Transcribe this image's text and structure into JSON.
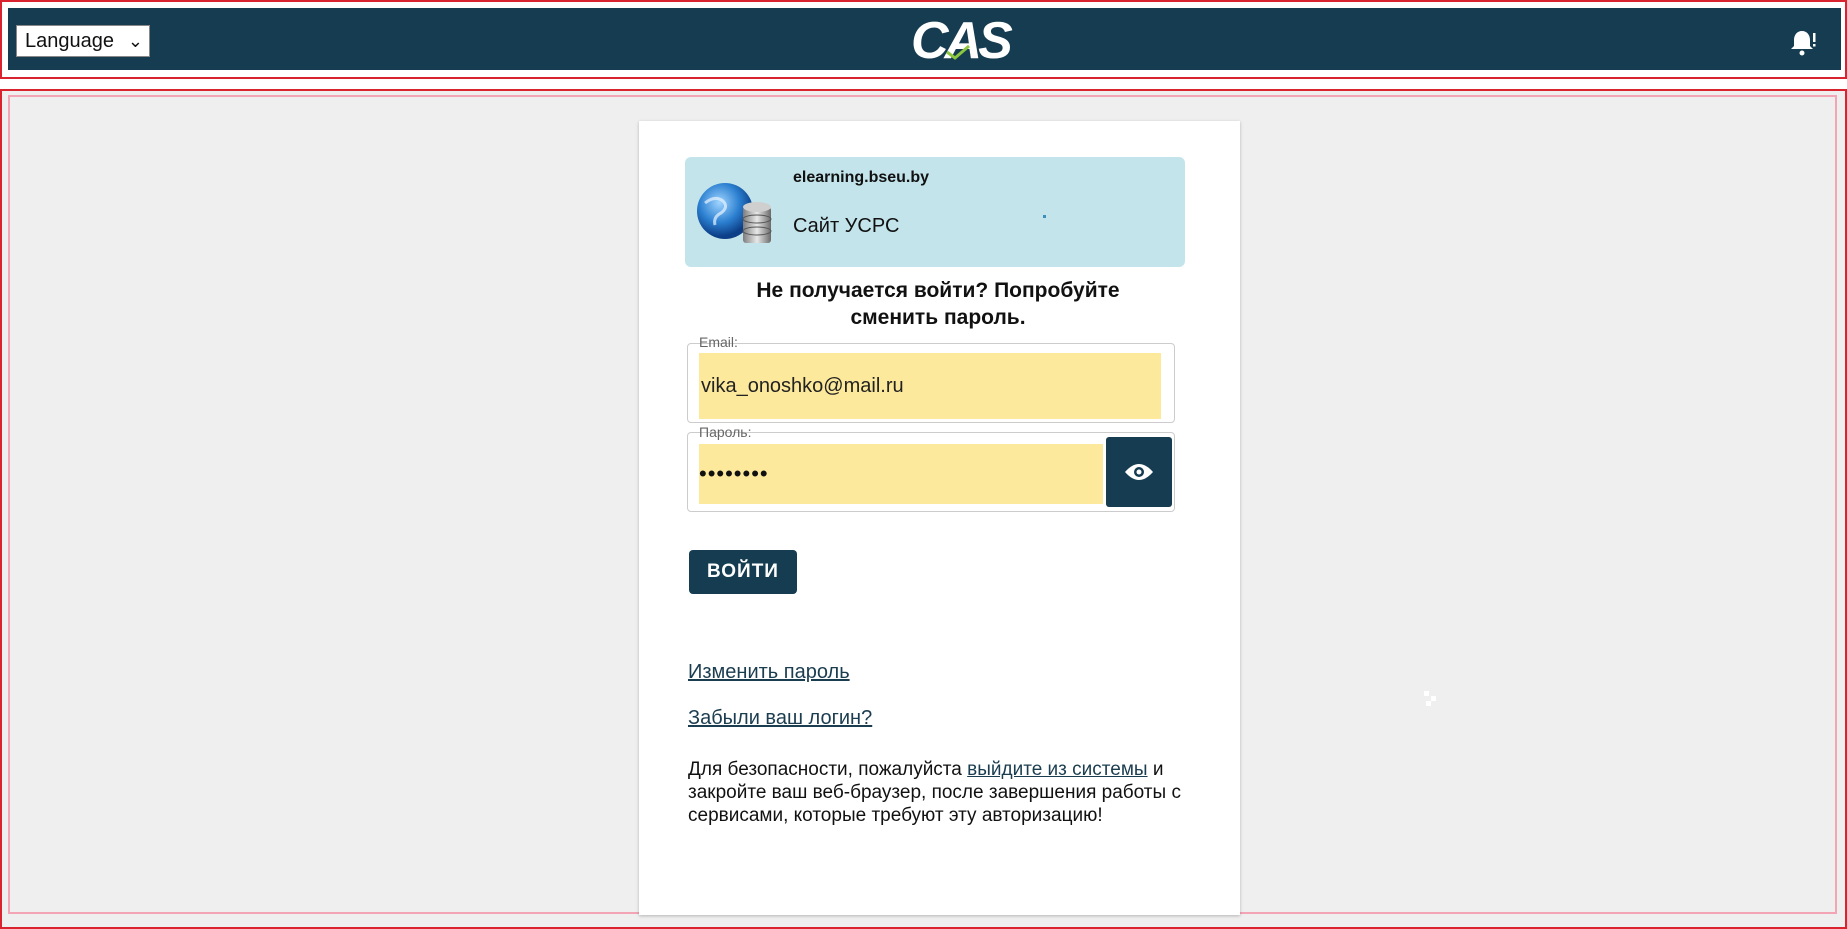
{
  "header": {
    "language_label": "Language",
    "logo_text": "CAS",
    "notification_icon": "bell-icon"
  },
  "service": {
    "host": "elearning.bseu.by",
    "name": "Сайт УСРС",
    "icon": "globe-database-icon"
  },
  "login": {
    "notice": "Не получается войти? Попробуйте сменить пароль.",
    "email_label": "Email:",
    "email_value": "vika_onoshko@mail.ru",
    "password_label": "Пароль:",
    "password_value": "••••••••",
    "show_password_icon": "eye-icon",
    "submit_label": "войти"
  },
  "links": {
    "change_password": "Изменить пароль",
    "forgot_login": "Забыли ваш логин?"
  },
  "security": {
    "text_before": "Для безопасности, пожалуйста ",
    "logout_link": "выйдите из системы",
    "text_after": " и закройте ваш веб-браузер, после завершения работы с сервисами, которые требуют эту авторизацию!"
  },
  "colors": {
    "header_bg": "#153c50",
    "autofill_bg": "#fde99b",
    "service_bg": "#c2e4ea",
    "page_bg": "#efefef"
  }
}
